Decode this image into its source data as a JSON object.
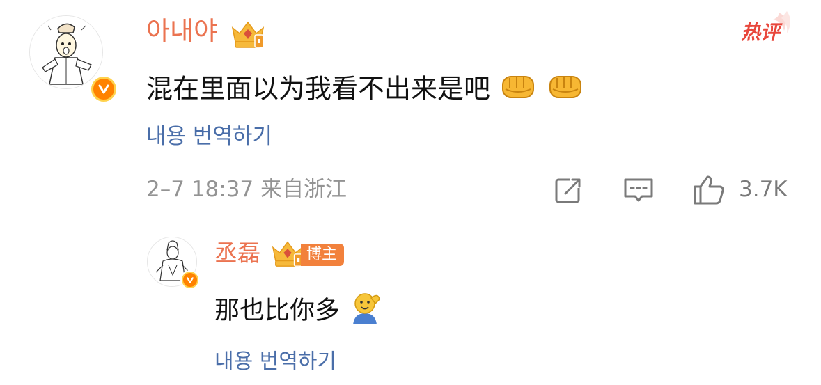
{
  "main_comment": {
    "username": "아내야",
    "text": "混在里面以为我看不出来是吧",
    "emojis": [
      "fist-emoji",
      "fist-emoji"
    ],
    "translate_label": "내용 번역하기",
    "meta": "2–7 18:37 来自浙江",
    "hot_badge": "热评",
    "like_count": "3.7K",
    "icons": [
      "share-icon",
      "comment-icon",
      "like-icon"
    ]
  },
  "reply": {
    "username": "丞磊",
    "badge_label": "博主",
    "text": "那也比你多",
    "emojis": [
      "salute-emoji"
    ],
    "translate_label": "내용 번역하기"
  },
  "colors": {
    "username": "#eb7350",
    "link": "#4a6ea9",
    "meta": "#939393",
    "hot": "#e8473c",
    "verified": "#ff8200"
  }
}
